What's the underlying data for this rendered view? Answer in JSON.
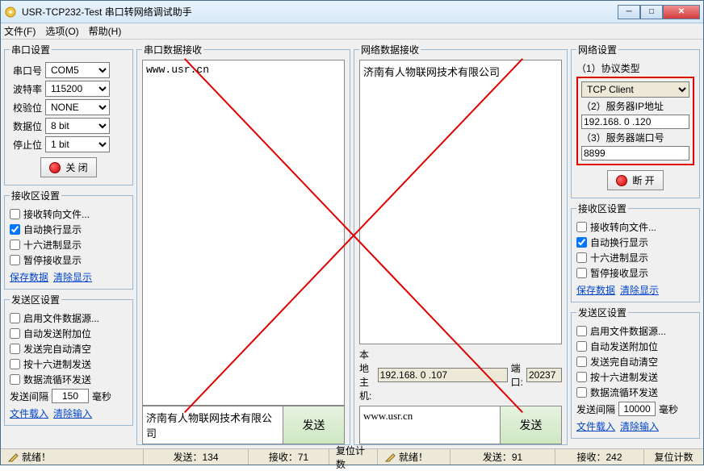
{
  "window": {
    "title": "USR-TCP232-Test 串口转网络调试助手"
  },
  "menu": {
    "file": "文件(F)",
    "options": "选项(O)",
    "help": "帮助(H)"
  },
  "serial": {
    "legend": "串口设置",
    "port_label": "串口号",
    "port": "COM5",
    "baud_label": "波特率",
    "baud": "115200",
    "parity_label": "校验位",
    "parity": "NONE",
    "data_label": "数据位",
    "data": "8 bit",
    "stop_label": "停止位",
    "stop": "1 bit",
    "close_btn": "关 闭"
  },
  "recv_area": {
    "legend": "接收区设置",
    "to_file": "接收转向文件...",
    "auto_wrap": "自动换行显示",
    "hex": "十六进制显示",
    "pause": "暂停接收显示",
    "save": "保存数据",
    "clear": "清除显示"
  },
  "send_area": {
    "legend": "发送区设置",
    "file_src": "启用文件数据源...",
    "auto_extra": "自动发送附加位",
    "done_clear": "发送完自动清空",
    "hex_send": "按十六进制发送",
    "loop": "数据流循环发送",
    "interval_label": "发送间隔",
    "interval_serial": "150",
    "interval_net": "10000",
    "ms": "毫秒",
    "file_load": "文件载入",
    "clear_input": "清除输入"
  },
  "serial_io": {
    "recv_legend": "串口数据接收",
    "recv_body": "www.usr.cn",
    "send_body": "济南有人物联网技术有限公司",
    "send_btn": "发送"
  },
  "net_io": {
    "recv_legend": "网络数据接收",
    "recv_body": "济南有人物联网技术有限公司",
    "local_host_label": "本地主机:",
    "local_host": "192.168. 0 .107",
    "port_label": "端口:",
    "port": "20237",
    "send_body": "www.usr.cn",
    "send_btn": "发送"
  },
  "net": {
    "legend": "网络设置",
    "proto_label": "（1）协议类型",
    "proto": "TCP Client",
    "ip_label": "（2）服务器IP地址",
    "ip": "192.168. 0 .120",
    "port_label": "（3）服务器端口号",
    "port": "8899",
    "disconnect_btn": "断 开"
  },
  "status": {
    "ready": "就绪！",
    "s_send_label": "发送：",
    "s_send": "134",
    "s_recv_label": "接收：",
    "s_recv": "71",
    "reset": "复位计数",
    "n_send_label": "发送：",
    "n_send": "91",
    "n_recv_label": "接收：",
    "n_recv": "242"
  }
}
